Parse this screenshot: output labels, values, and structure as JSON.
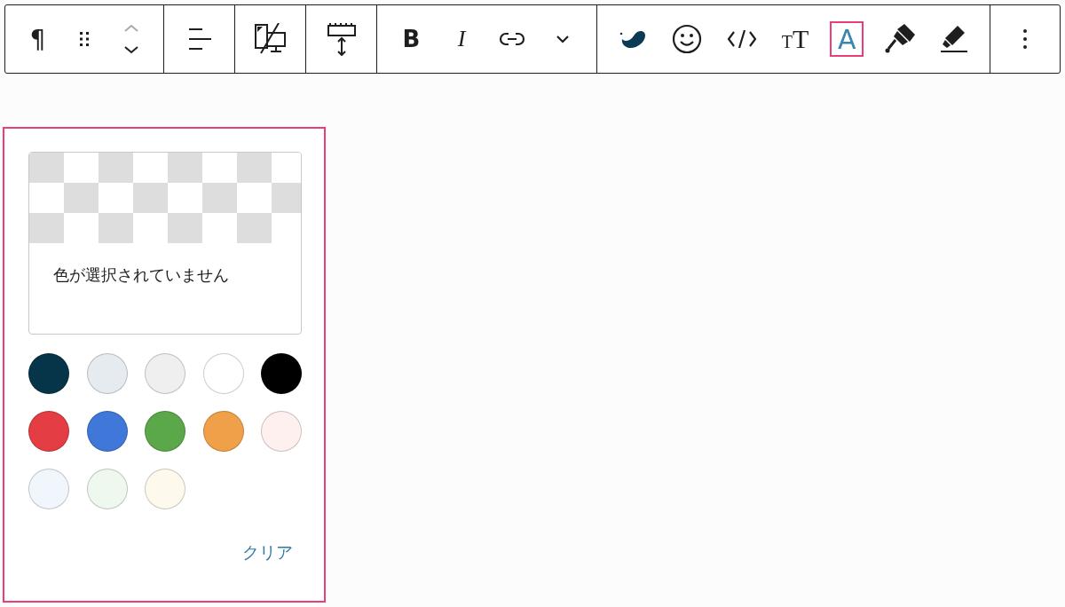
{
  "toolbar": {
    "groups": [
      [
        {
          "kind": "paragraph",
          "label": "¶",
          "selected": false
        },
        {
          "kind": "drag",
          "selected": false
        },
        {
          "kind": "updown",
          "selected": false
        }
      ],
      [
        {
          "kind": "align",
          "selected": false
        }
      ],
      [
        {
          "kind": "device",
          "selected": false
        }
      ],
      [
        {
          "kind": "spacing",
          "selected": false
        }
      ],
      [
        {
          "kind": "bold",
          "label": "B",
          "selected": false
        },
        {
          "kind": "italic",
          "label": "I",
          "selected": false
        },
        {
          "kind": "link",
          "selected": false
        },
        {
          "kind": "chevron",
          "selected": false
        }
      ],
      [
        {
          "kind": "drop",
          "selected": false
        },
        {
          "kind": "emoji",
          "selected": false
        },
        {
          "kind": "code",
          "selected": false
        },
        {
          "kind": "fontsize",
          "label": "$_{T}$T",
          "selected": false
        },
        {
          "kind": "textcolor",
          "label": "A",
          "selected": true
        },
        {
          "kind": "brush",
          "selected": false
        },
        {
          "kind": "marker",
          "selected": false
        }
      ],
      [
        {
          "kind": "more",
          "selected": false
        }
      ]
    ]
  },
  "color_popover": {
    "preview_text": "色が選択されていません",
    "swatches": [
      {
        "color": "#063549"
      },
      {
        "color": "#e6ebef"
      },
      {
        "color": "#efefef"
      },
      {
        "color": "#ffffff"
      },
      {
        "color": "#000000"
      },
      {
        "color": "#e43d44"
      },
      {
        "color": "#3f78d8"
      },
      {
        "color": "#5ba84a"
      },
      {
        "color": "#f0a048"
      },
      {
        "color": "#fdf0ee"
      },
      {
        "color": "#f1f6fd"
      },
      {
        "color": "#eff8ee"
      },
      {
        "color": "#fdf9ed"
      }
    ],
    "clear_button": "クリア"
  }
}
